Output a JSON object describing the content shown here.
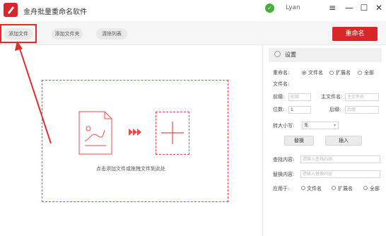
{
  "app": {
    "title": "金舟批量重命名软件",
    "user": "Lyan"
  },
  "toolbar": {
    "add_file": "添加文件",
    "add_folder": "添加文件夹",
    "clear_list": "清除列表",
    "rename": "重命名"
  },
  "main": {
    "drop_hint": "点击添加文件或拖拽文件到此处"
  },
  "settings": {
    "title": "设置",
    "rename_label": "重命名:",
    "rename_options": [
      "文件名",
      "扩展名",
      "全部"
    ],
    "rename_selected": "文件名",
    "filename_label": "文件名:",
    "prefix_label": "前缀:",
    "prefix_placeholder": "前缀",
    "main_name_label": "主文件名:",
    "main_name_placeholder": "主文件名",
    "digits_label": "位数:",
    "digits_value": "1",
    "suffix_label": "后缀:",
    "suffix_placeholder": "后缀",
    "case_label": "转大小写:",
    "case_value": "无",
    "replace_button": "替换",
    "insert_button": "插入",
    "find_label": "查找内容:",
    "find_placeholder": "请输入查找内容",
    "replace_label": "替换内容:",
    "replace_placeholder": "请输入替换内容",
    "apply_label": "应用于:",
    "apply_options": [
      "文件名",
      "扩展名",
      "全部"
    ]
  },
  "colors": {
    "accent": "#d9262b",
    "annotation": "#e12b2b"
  }
}
